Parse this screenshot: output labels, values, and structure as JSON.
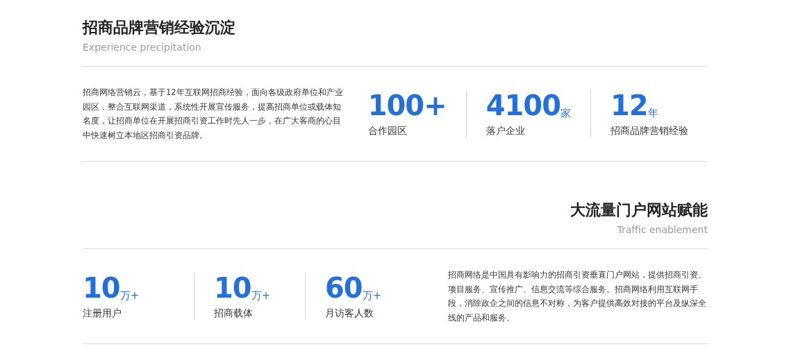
{
  "sections": [
    {
      "kind": "text-first",
      "title": "招商品牌营销经验沉淀",
      "subtitle": "Experience precipitation",
      "description": "招商网络营销云，基于12年互联网招商经验，面向各级政府单位和产业园区，整合互联网渠道，系统性开展宣传服务，提高招商单位或载体知名度，让招商单位在开展招商引资工作时先人一步，在广大客商的心目中快速树立本地区招商引资品牌。",
      "stats": [
        {
          "number": "100+",
          "label": "合作园区"
        },
        {
          "number": "4100",
          "unit": "家",
          "label": "落户企业"
        },
        {
          "number": "12",
          "unit": "年",
          "label": "招商品牌营销经验"
        }
      ]
    },
    {
      "kind": "stats-first",
      "title": "大流量门户网站赋能",
      "subtitle": "Traffic enablement",
      "description": "招商网络是中国具有影响力的招商引资垂直门户网站，提供招商引资、项目服务、宣传推广、信息交流等综合服务。招商网络利用互联网手段，消除政企之间的信息不对称，为客户提供高效对接的平台及纵深全线的产品和服务。",
      "stats": [
        {
          "number": "10",
          "unit": "万+",
          "label": "注册用户"
        },
        {
          "number": "10",
          "unit": "万+",
          "label": "招商载体"
        },
        {
          "number": "60",
          "unit": "万+",
          "label": "月访客人数"
        }
      ]
    }
  ]
}
